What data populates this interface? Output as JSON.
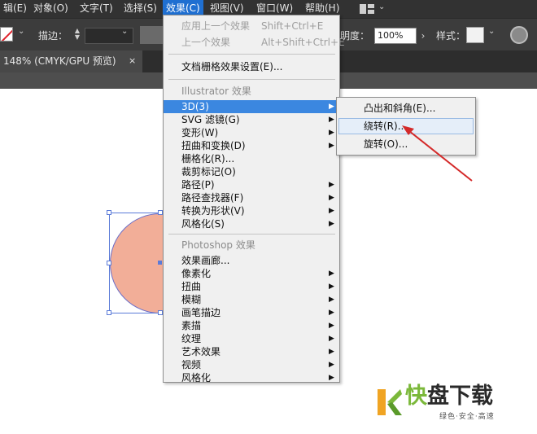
{
  "menubar": {
    "items": [
      "辑(E)",
      "对象(O)",
      "文字(T)",
      "选择(S)",
      "效果(C)",
      "视图(V)",
      "窗口(W)",
      "帮助(H)"
    ],
    "active_index": 4
  },
  "control_bar": {
    "stroke_label": "描边：",
    "opacity_label": "明度：",
    "opacity_value": "100%",
    "style_label": "样式：",
    "none_color": "#e0202a"
  },
  "tab": {
    "label": "148% (CMYK/GPU 预览)",
    "close": "×"
  },
  "effect_menu": {
    "top_items": [
      {
        "label": "应用上一个效果",
        "shortcut": "Shift+Ctrl+E"
      },
      {
        "label": "上一个效果",
        "shortcut": "Alt+Shift+Ctrl+E"
      }
    ],
    "document_raster": "文档栅格效果设置(E)...",
    "illustrator_heading": "Illustrator 效果",
    "illustrator_items": [
      {
        "label": "3D(3)"
      },
      {
        "label": "SVG 滤镜(G)"
      },
      {
        "label": "变形(W)"
      },
      {
        "label": "扭曲和变换(D)"
      },
      {
        "label": "栅格化(R)..."
      },
      {
        "label": "裁剪标记(O)"
      },
      {
        "label": "路径(P)"
      },
      {
        "label": "路径查找器(F)"
      },
      {
        "label": "转换为形状(V)"
      },
      {
        "label": "风格化(S)"
      }
    ],
    "photoshop_heading": "Photoshop 效果",
    "photoshop_items": [
      {
        "label": "效果画廊..."
      },
      {
        "label": "像素化"
      },
      {
        "label": "扭曲"
      },
      {
        "label": "模糊"
      },
      {
        "label": "画笔描边"
      },
      {
        "label": "素描"
      },
      {
        "label": "纹理"
      },
      {
        "label": "艺术效果"
      },
      {
        "label": "视频"
      },
      {
        "label": "风格化"
      }
    ],
    "submenu_arrow": "▶"
  },
  "submenu_3d": {
    "items": [
      "凸出和斜角(E)...",
      "绕转(R)...",
      "旋转(O)..."
    ],
    "hover_index": 1
  },
  "canvas": {
    "circle_fill": "#f2ae98",
    "selection_color": "#5b7bd8",
    "annotation_arrow_color": "#d42a2a"
  },
  "watermark": {
    "main_green": "快",
    "main_dark": "盘下载",
    "tagline": "绿色·安全·高速",
    "green": "#7bb83a"
  }
}
